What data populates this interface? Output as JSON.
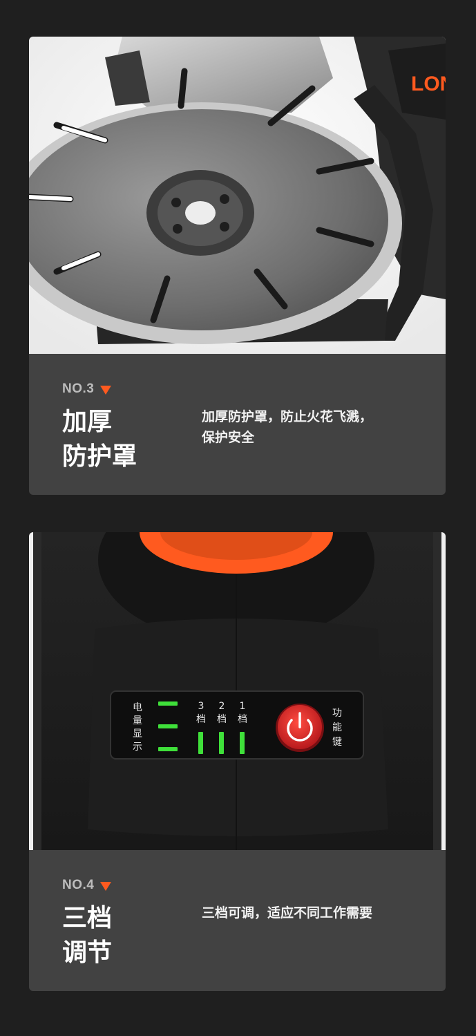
{
  "sections": [
    {
      "number": "NO.3",
      "title_line1": "加厚",
      "title_line2": "防护罩",
      "desc_line1": "加厚防护罩，防止火花飞溅，",
      "desc_line2": "保护安全",
      "brand_logo_text": "LON"
    },
    {
      "number": "NO.4",
      "title_line1": "三档",
      "title_line2": "调节",
      "desc_line1": "三档可调，适应不同工作需要",
      "desc_line2": "",
      "panel": {
        "battery_label": [
          "电",
          "量",
          "显",
          "示"
        ],
        "gears": [
          {
            "num": "3",
            "label": "档"
          },
          {
            "num": "2",
            "label": "档"
          },
          {
            "num": "1",
            "label": "档"
          }
        ],
        "function_label": [
          "功",
          "能",
          "键"
        ]
      }
    }
  ],
  "colors": {
    "accent_orange": "#ff5a1f",
    "indicator_green": "#3fe03a",
    "power_red": "#e8262a"
  }
}
